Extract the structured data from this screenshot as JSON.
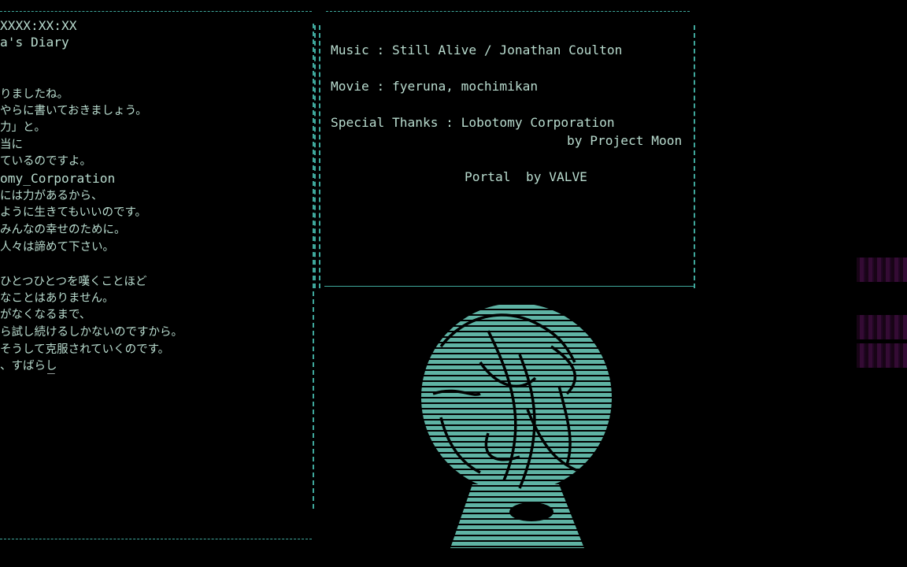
{
  "diary": {
    "date": "XXXX:XX:XX",
    "title": "a's Diary",
    "lines": [
      "りましたね。",
      "やらに書いておきましょう。",
      "力」と。",
      "当に",
      "ているのですよ。",
      "omy_Corporation",
      "には力があるから、",
      "ように生きてもいいのです。",
      "みんなの幸せのために。",
      "人々は諦めて下さい。",
      "",
      "ひとつひとつを嘆くことほど",
      "なことはありません。",
      "がなくなるまで、",
      "ら試し続けるしかないのですから。",
      "そうして克服されていくのです。",
      "、すばらし"
    ],
    "cursor": "_"
  },
  "credits": {
    "music": "Music : Still Alive / Jonathan Coulton",
    "movie": "Movie : fyeruna, mochimikan",
    "thanks": "Special Thanks : Lobotomy Corporation",
    "thanks_by": "by Project Moon",
    "portal": "Portal  by VALVE"
  },
  "colors": {
    "text": "#b9dccf",
    "border": "#3fa89c",
    "art": "#5fb3a4",
    "accent_strip": "#3a0c3a"
  },
  "art": {
    "icon": "aperture-globe-ascii-art"
  }
}
